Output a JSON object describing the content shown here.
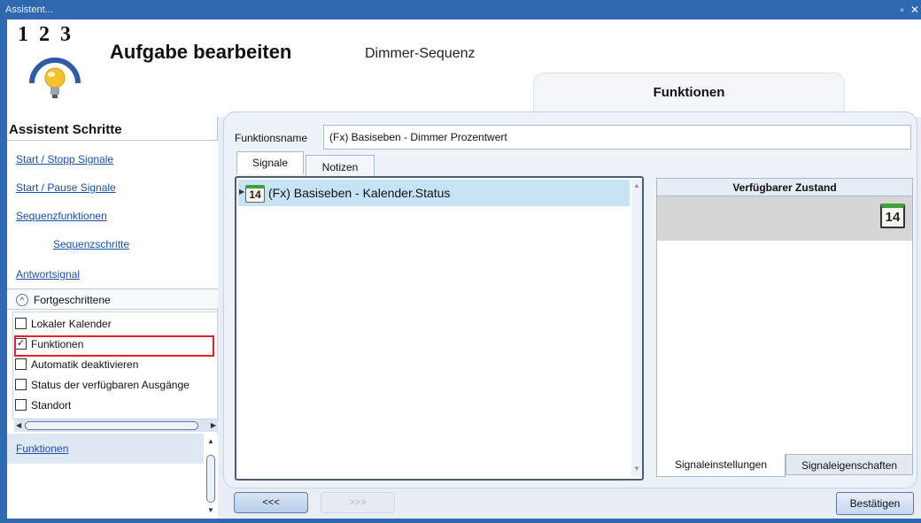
{
  "window": {
    "title": "Assistent...",
    "restore_glyph": "▫",
    "close_glyph": "✕"
  },
  "header": {
    "logo_digits": "1 2 3",
    "title": "Aufgabe bearbeiten",
    "subtitle": "Dimmer-Sequenz",
    "active_tab": "Funktionen"
  },
  "sidebar": {
    "title": "Assistent Schritte",
    "steps": [
      {
        "label": "Start / Stopp Signale"
      },
      {
        "label": "Start / Pause Signale"
      },
      {
        "label": "Sequenzfunktionen"
      },
      {
        "label": "Sequenzschritte"
      },
      {
        "label": "Antwortsignal"
      }
    ],
    "advanced": {
      "label": "Fortgeschrittene",
      "toggle_glyph": "^",
      "items": [
        {
          "label": "Lokaler Kalender",
          "checked": false
        },
        {
          "label": "Funktionen",
          "checked": true
        },
        {
          "label": "Automatik deaktivieren",
          "checked": false
        },
        {
          "label": "Status der verfügbaren Ausgänge",
          "checked": false
        },
        {
          "label": "Standort",
          "checked": false
        }
      ]
    },
    "current_step": "Funktionen"
  },
  "content": {
    "function_name_label": "Funktionsname",
    "function_name_value": "(Fx) Basiseben - Dimmer Prozentwert",
    "tabs": [
      {
        "label": "Signale",
        "active": true
      },
      {
        "label": "Notizen",
        "active": false
      }
    ],
    "signals": [
      {
        "icon": "calendar-icon",
        "day": "14",
        "label": "(Fx) Basiseben - Kalender.Status"
      }
    ],
    "states": {
      "header": "Verfügbarer Zustand",
      "icon_day": "14"
    },
    "bottom_tabs": [
      {
        "label": "Signaleinstellungen",
        "active": true
      },
      {
        "label": "Signaleigenschaften",
        "active": false
      }
    ]
  },
  "footer": {
    "prev_label": "<<<",
    "next_label": ">>>",
    "confirm_label": "Bestätigen"
  },
  "colors": {
    "titlebar": "#2e68b0",
    "link": "#1a4fb0",
    "highlight": "#e0232a",
    "selection": "#c6e3f6",
    "calendar_green": "#3ea13a"
  }
}
